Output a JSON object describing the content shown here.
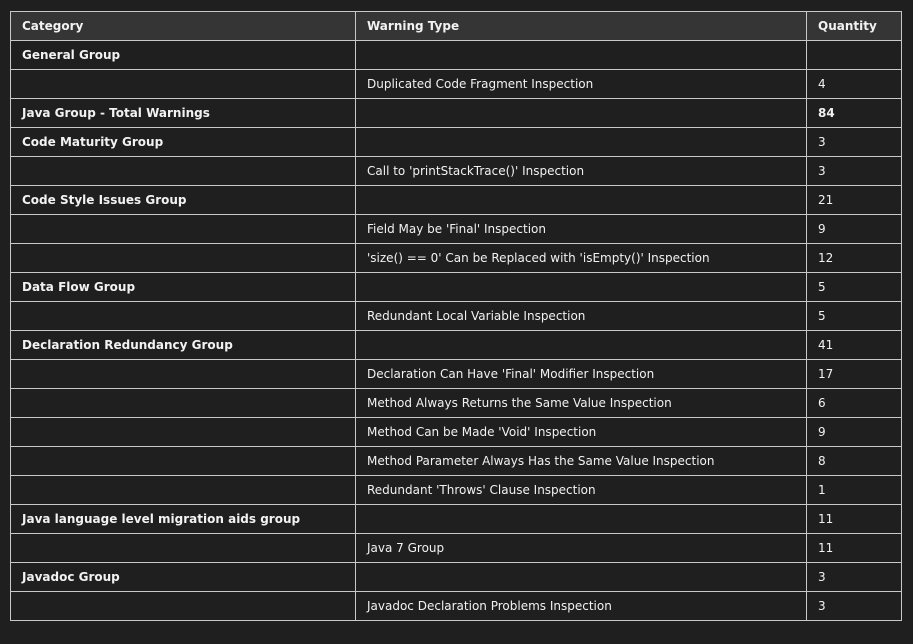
{
  "table": {
    "headers": [
      "Category",
      "Warning Type",
      "Quantity"
    ],
    "rows": [
      {
        "category": "General Group",
        "warning": "",
        "quantity": "",
        "kind": "group"
      },
      {
        "category": "",
        "warning": "Duplicated Code Fragment Inspection",
        "quantity": "4",
        "kind": "item"
      },
      {
        "category": "Java Group - Total Warnings",
        "warning": "",
        "quantity": "84",
        "kind": "total"
      },
      {
        "category": "Code Maturity Group",
        "warning": "",
        "quantity": "3",
        "kind": "group"
      },
      {
        "category": "",
        "warning": "Call to 'printStackTrace()' Inspection",
        "quantity": "3",
        "kind": "item"
      },
      {
        "category": "Code Style Issues Group",
        "warning": "",
        "quantity": "21",
        "kind": "group"
      },
      {
        "category": "",
        "warning": "Field May be 'Final' Inspection",
        "quantity": "9",
        "kind": "item"
      },
      {
        "category": "",
        "warning": "'size() == 0' Can be Replaced with 'isEmpty()' Inspection",
        "quantity": "12",
        "kind": "item"
      },
      {
        "category": "Data Flow Group",
        "warning": "",
        "quantity": "5",
        "kind": "group"
      },
      {
        "category": "",
        "warning": "Redundant Local Variable Inspection",
        "quantity": "5",
        "kind": "item"
      },
      {
        "category": "Declaration Redundancy Group",
        "warning": "",
        "quantity": "41",
        "kind": "group"
      },
      {
        "category": "",
        "warning": "Declaration Can Have 'Final' Modifier Inspection",
        "quantity": "17",
        "kind": "item"
      },
      {
        "category": "",
        "warning": "Method Always Returns the Same Value Inspection",
        "quantity": "6",
        "kind": "item"
      },
      {
        "category": "",
        "warning": "Method Can be Made 'Void' Inspection",
        "quantity": "9",
        "kind": "item"
      },
      {
        "category": "",
        "warning": "Method Parameter Always Has the Same Value Inspection",
        "quantity": "8",
        "kind": "item"
      },
      {
        "category": "",
        "warning": "Redundant 'Throws' Clause Inspection",
        "quantity": "1",
        "kind": "item"
      },
      {
        "category": "Java language level migration aids group",
        "warning": "",
        "quantity": "11",
        "kind": "group"
      },
      {
        "category": "",
        "warning": "Java 7 Group",
        "quantity": "11",
        "kind": "item"
      },
      {
        "category": "Javadoc Group",
        "warning": "",
        "quantity": "3",
        "kind": "group"
      },
      {
        "category": "",
        "warning": "Javadoc Declaration Problems Inspection",
        "quantity": "3",
        "kind": "item"
      }
    ]
  }
}
